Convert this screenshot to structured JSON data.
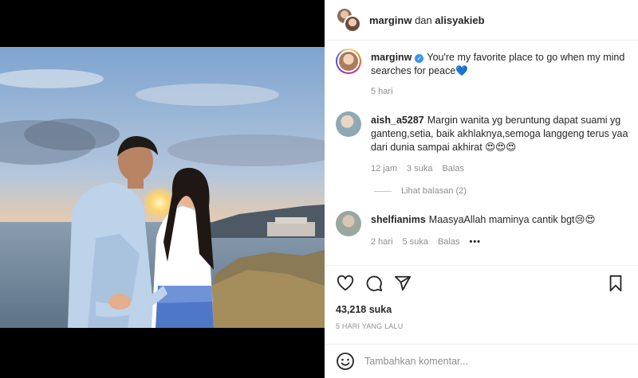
{
  "header": {
    "user1": "marginw",
    "joiner": " dan ",
    "user2": "alisyakieb"
  },
  "caption": {
    "username": "marginw",
    "verified_glyph": "✓",
    "text": "You're my favorite place to go when my mind searches for peace💙",
    "time": "5 hari"
  },
  "comments": [
    {
      "username": "aish_a5287",
      "text": "Margin wanita yg beruntung dapat suami yg ganteng,setia, baik akhlaknya,semoga langgeng terus yaa dari dunia sampai akhirat 😍😍😍",
      "time": "12 jam",
      "likes": "3 suka",
      "reply": "Balas"
    },
    {
      "username": "shelfianims",
      "text": "MaasyaAllah maminya cantik bgt😢😍",
      "time": "2 hari",
      "likes": "5 suka",
      "reply": "Balas",
      "more": "•••"
    }
  ],
  "view_replies": "Lihat balasan (2)",
  "post": {
    "likes": "43,218 suka",
    "age": "5 HARI YANG LALU"
  },
  "composer": {
    "placeholder": "Tambahkan komentar..."
  },
  "icons": {
    "like": "heart-icon",
    "comment": "comment-icon",
    "share": "share-icon",
    "save": "bookmark-icon",
    "emoji": "emoji-icon"
  },
  "colors": {
    "verified": "#3897f0",
    "muted": "#8e8e8e",
    "text": "#262626"
  }
}
